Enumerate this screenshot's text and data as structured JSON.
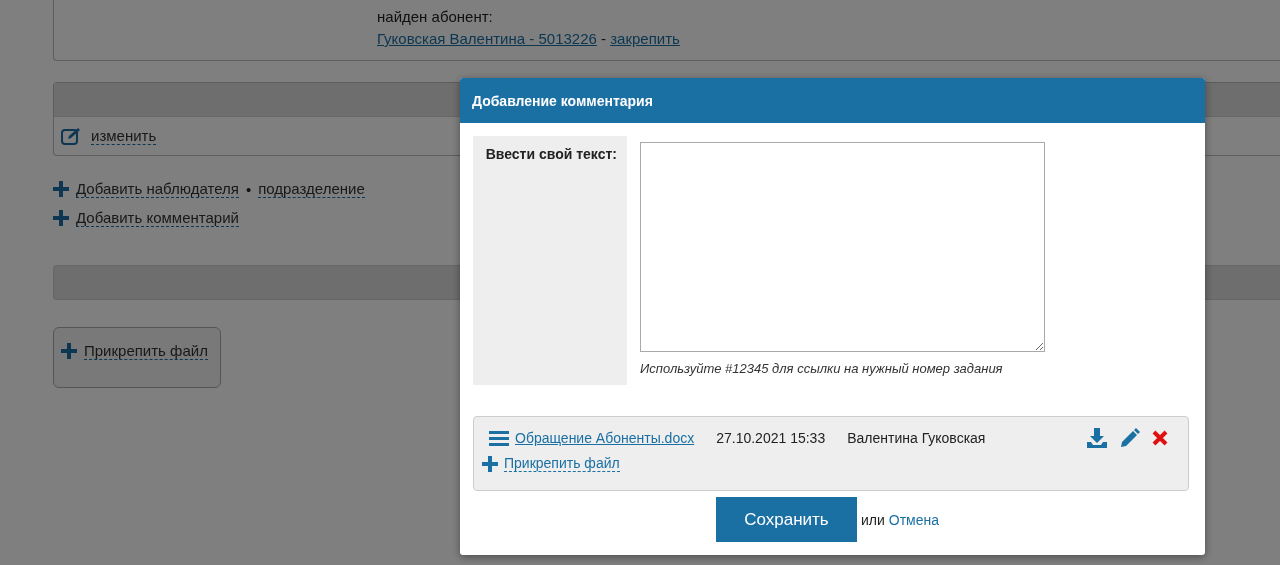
{
  "background": {
    "found_label": "найден абонент:",
    "subscriber_link": "Гуковская Валентина - 5013226",
    "separator": "-",
    "pin_link": "закрепить",
    "edit_link": "изменить",
    "add_watcher": "Добавить наблюдателя",
    "bullet": "•",
    "department": "подразделение",
    "add_comment": "Добавить комментарий",
    "attach_file": "Прикрепить файл"
  },
  "dialog": {
    "title": "Добавление комментария",
    "text_label": "Ввести свой текст:",
    "hint": "Используйте #12345 для ссылки на нужный номер задания",
    "files": [
      {
        "name": "Обращение Абоненты.docx",
        "date": "27.10.2021 15:33",
        "author": "Валентина Гуковская"
      }
    ],
    "attach_file": "Прикрепить файл",
    "save": "Сохранить",
    "or": "или",
    "cancel": "Отмена"
  }
}
